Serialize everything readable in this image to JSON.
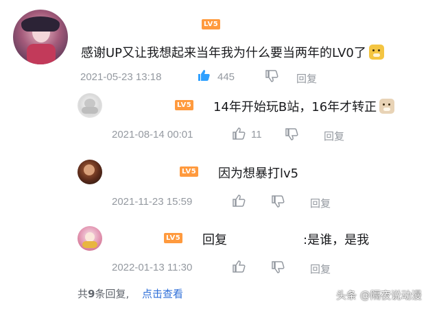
{
  "colors": {
    "level_badge": "#ff9a3e",
    "liked_thumb": "#2fa0ff",
    "meta_gray": "#9499a0",
    "link_blue": "#2f6fd8"
  },
  "comment": {
    "level": "LV5",
    "text": "感谢UP又让我想起来当年我为什么要当两年的LV0了",
    "emoji": "doge-emoji",
    "time": "2021-05-23 13:18",
    "likes": "445",
    "reply_label": "回复"
  },
  "replies": [
    {
      "level": "LV5",
      "text": "14年开始玩B站，16年才转正",
      "emoji": "doge-emoji",
      "time": "2021-08-14 00:01",
      "likes": "11",
      "reply_label": "回复"
    },
    {
      "level": "LV5",
      "text": "因为想暴打lv5",
      "time": "2021-11-23 15:59",
      "reply_label": "回复"
    },
    {
      "level": "LV5",
      "text_prefix": "回复",
      "text_suffix": ":是谁，是我",
      "time": "2022-01-13 11:30",
      "reply_label": "回复"
    }
  ],
  "footer": {
    "count_pre": "共",
    "count_num": "9",
    "count_post": "条回复,",
    "view_link": "点击查看"
  },
  "watermark": "头条 @隔夜说动漫"
}
